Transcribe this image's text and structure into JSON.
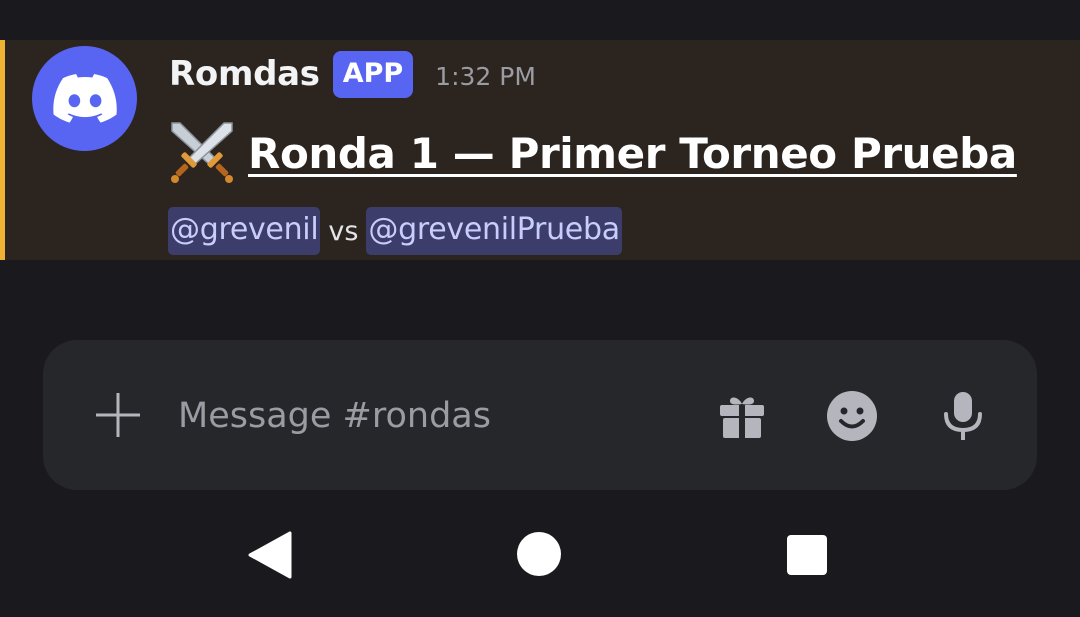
{
  "message": {
    "author": "Romdas",
    "badge": "APP",
    "timestamp": "1:32 PM",
    "title_emoji": "crossed-swords-icon",
    "title": "Ronda 1 — Primer Torneo Prueba",
    "mention_1": "@grevenil",
    "vs_text": "vs",
    "mention_2": "@grevenilPrueba",
    "avatar_icon": "discord-logo-icon",
    "highlight_color": "#f0b232",
    "accent_color": "#5865f2"
  },
  "composer": {
    "placeholder": "Message #rondas",
    "value": "",
    "icons": [
      "plus-icon",
      "gift-icon",
      "emoji-icon",
      "microphone-icon"
    ]
  },
  "navbar": {
    "icons": [
      "back-icon",
      "home-icon",
      "recents-icon"
    ]
  }
}
